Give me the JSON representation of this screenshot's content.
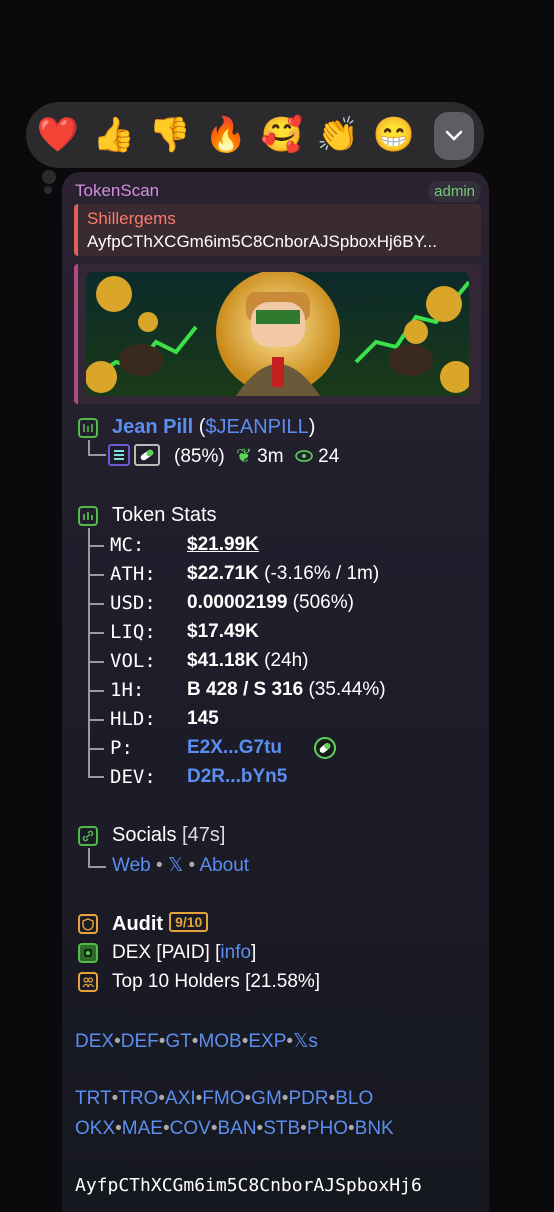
{
  "reactions": [
    {
      "icon": "red-heart-icon",
      "glyph": "❤️"
    },
    {
      "icon": "thumbs-up-icon",
      "glyph": "👍"
    },
    {
      "icon": "thumbs-down-icon",
      "glyph": "👎"
    },
    {
      "icon": "fire-icon",
      "glyph": "🔥"
    },
    {
      "icon": "smiling-face-hearts-icon",
      "glyph": "🥰"
    },
    {
      "icon": "clapping-hands-icon",
      "glyph": "👏"
    },
    {
      "icon": "grinning-face-icon",
      "glyph": "😁"
    }
  ],
  "message": {
    "sender": "TokenScan",
    "role": "admin",
    "reply": {
      "name": "Shillergems",
      "text": "AyfpCThXCGm6im5C8CnborAJSpboxHj6BY..."
    }
  },
  "token": {
    "name": "Jean Pill",
    "ticker_open": "(",
    "ticker": "$JEANPILL",
    "ticker_close": ")",
    "percent": "(85%)",
    "age": "3m",
    "views": "24"
  },
  "stats": {
    "heading": "Token Stats",
    "rows": [
      {
        "label": "MC:",
        "value": "$21.99K",
        "extra": ""
      },
      {
        "label": "ATH:",
        "value": "$22.71K",
        "extra": " (-3.16% / 1m)"
      },
      {
        "label": "USD:",
        "value": "0.00002199",
        "extra": " (506%)"
      },
      {
        "label": "LIQ:",
        "value": "$17.49K",
        "extra": ""
      },
      {
        "label": "VOL:",
        "value": "$41.18K",
        "extra": " (24h)"
      },
      {
        "label": "1H:",
        "value": "B 428 / S 316",
        "extra": " (35.44%)"
      },
      {
        "label": "HLD:",
        "value": "145",
        "extra": ""
      },
      {
        "label": "P:",
        "value": "E2X...G7tu",
        "extra": ""
      },
      {
        "label": "DEV:",
        "value": "D2R...bYn5",
        "extra": ""
      }
    ]
  },
  "socials": {
    "heading": "Socials",
    "age": "[47s]",
    "web": "Web",
    "x": "𝕏",
    "sep": "•",
    "about": "About"
  },
  "audit": {
    "heading": "Audit",
    "score": "9/10",
    "dex": "DEX [PAID] [",
    "info": "info",
    "dex_close": "]",
    "holders": "Top 10 Holders [21.58%]"
  },
  "links1": [
    "DEX",
    "DEF",
    "GT",
    "MOB",
    "EXP",
    "𝕏s"
  ],
  "links2": [
    "TRT",
    "TRO",
    "AXI",
    "FMO",
    "GM",
    "PDR",
    "BLO"
  ],
  "links3": [
    "OKX",
    "MAE",
    "COV",
    "BAN",
    "STB",
    "PHO",
    "BNK"
  ],
  "contract": "AyfpCThXCGm6im5C8CnborAJSpboxHj6",
  "colors": {
    "accent_green": "#54b94a",
    "accent_orange": "#e3a538",
    "link": "#5b8ef0",
    "sender": "#d48fe0"
  }
}
